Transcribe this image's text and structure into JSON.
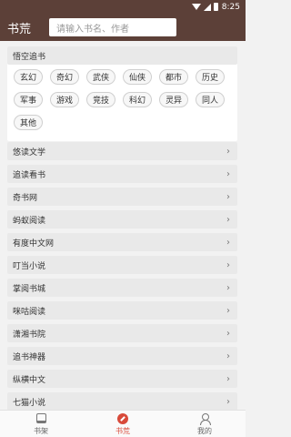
{
  "status_bar": {
    "time": "8:25"
  },
  "header": {
    "title": "书荒",
    "search_placeholder": "请输入书名、作者"
  },
  "featured": {
    "title": "悟空追书",
    "tags": [
      "玄幻",
      "奇幻",
      "武侠",
      "仙侠",
      "都市",
      "历史",
      "军事",
      "游戏",
      "竞技",
      "科幻",
      "灵异",
      "同人",
      "其他"
    ]
  },
  "sources": [
    "悠读文学",
    "追读看书",
    "奇书网",
    "蚂蚁阅读",
    "有度中文网",
    "叮当小说",
    "掌阅书城",
    "咪咕阅读",
    "潇湘书院",
    "追书神器",
    "纵横中文",
    "七猫小说"
  ],
  "bottom_nav": [
    {
      "label": "书架",
      "icon": "bookshelf-icon"
    },
    {
      "label": "书荒",
      "icon": "discover-icon"
    },
    {
      "label": "我的",
      "icon": "profile-icon"
    }
  ],
  "colors": {
    "primary": "#5c4038",
    "accent": "#d84a3a"
  }
}
